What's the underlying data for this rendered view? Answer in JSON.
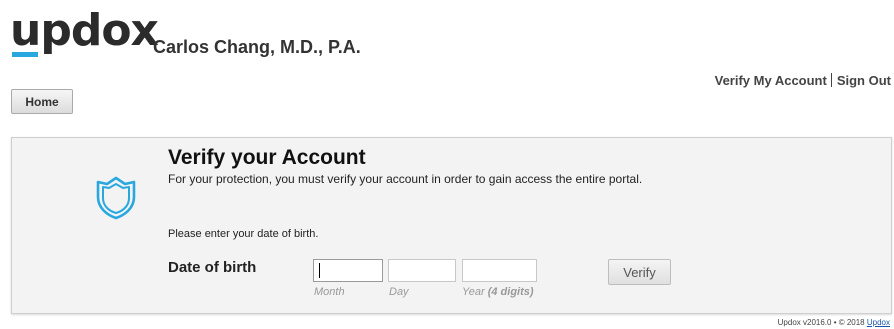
{
  "header": {
    "logo_text": "updox",
    "practice_name": "Carlos Chang, M.D., P.A.",
    "links": {
      "verify_account": "Verify My Account",
      "sign_out": "Sign Out"
    },
    "home_label": "Home"
  },
  "verify": {
    "title": "Verify your Account",
    "description": "For your protection, you must verify your account in order to gain access the entire portal.",
    "dob_prompt": "Please enter your date of birth.",
    "dob_label": "Date of birth",
    "fields": {
      "month": {
        "value": "",
        "hint": "Month"
      },
      "day": {
        "value": "",
        "hint": "Day"
      },
      "year": {
        "value": "",
        "hint": "Year",
        "hint_bold": "(4 digits)"
      }
    },
    "button_label": "Verify",
    "icon": "shield-icon"
  },
  "footer": {
    "text": "Updox v2016.0 • © 2018",
    "link": "Updox"
  },
  "colors": {
    "accent": "#29a8e0",
    "panel_bg": "#f3f3f3",
    "shield": "#29a8e0"
  }
}
